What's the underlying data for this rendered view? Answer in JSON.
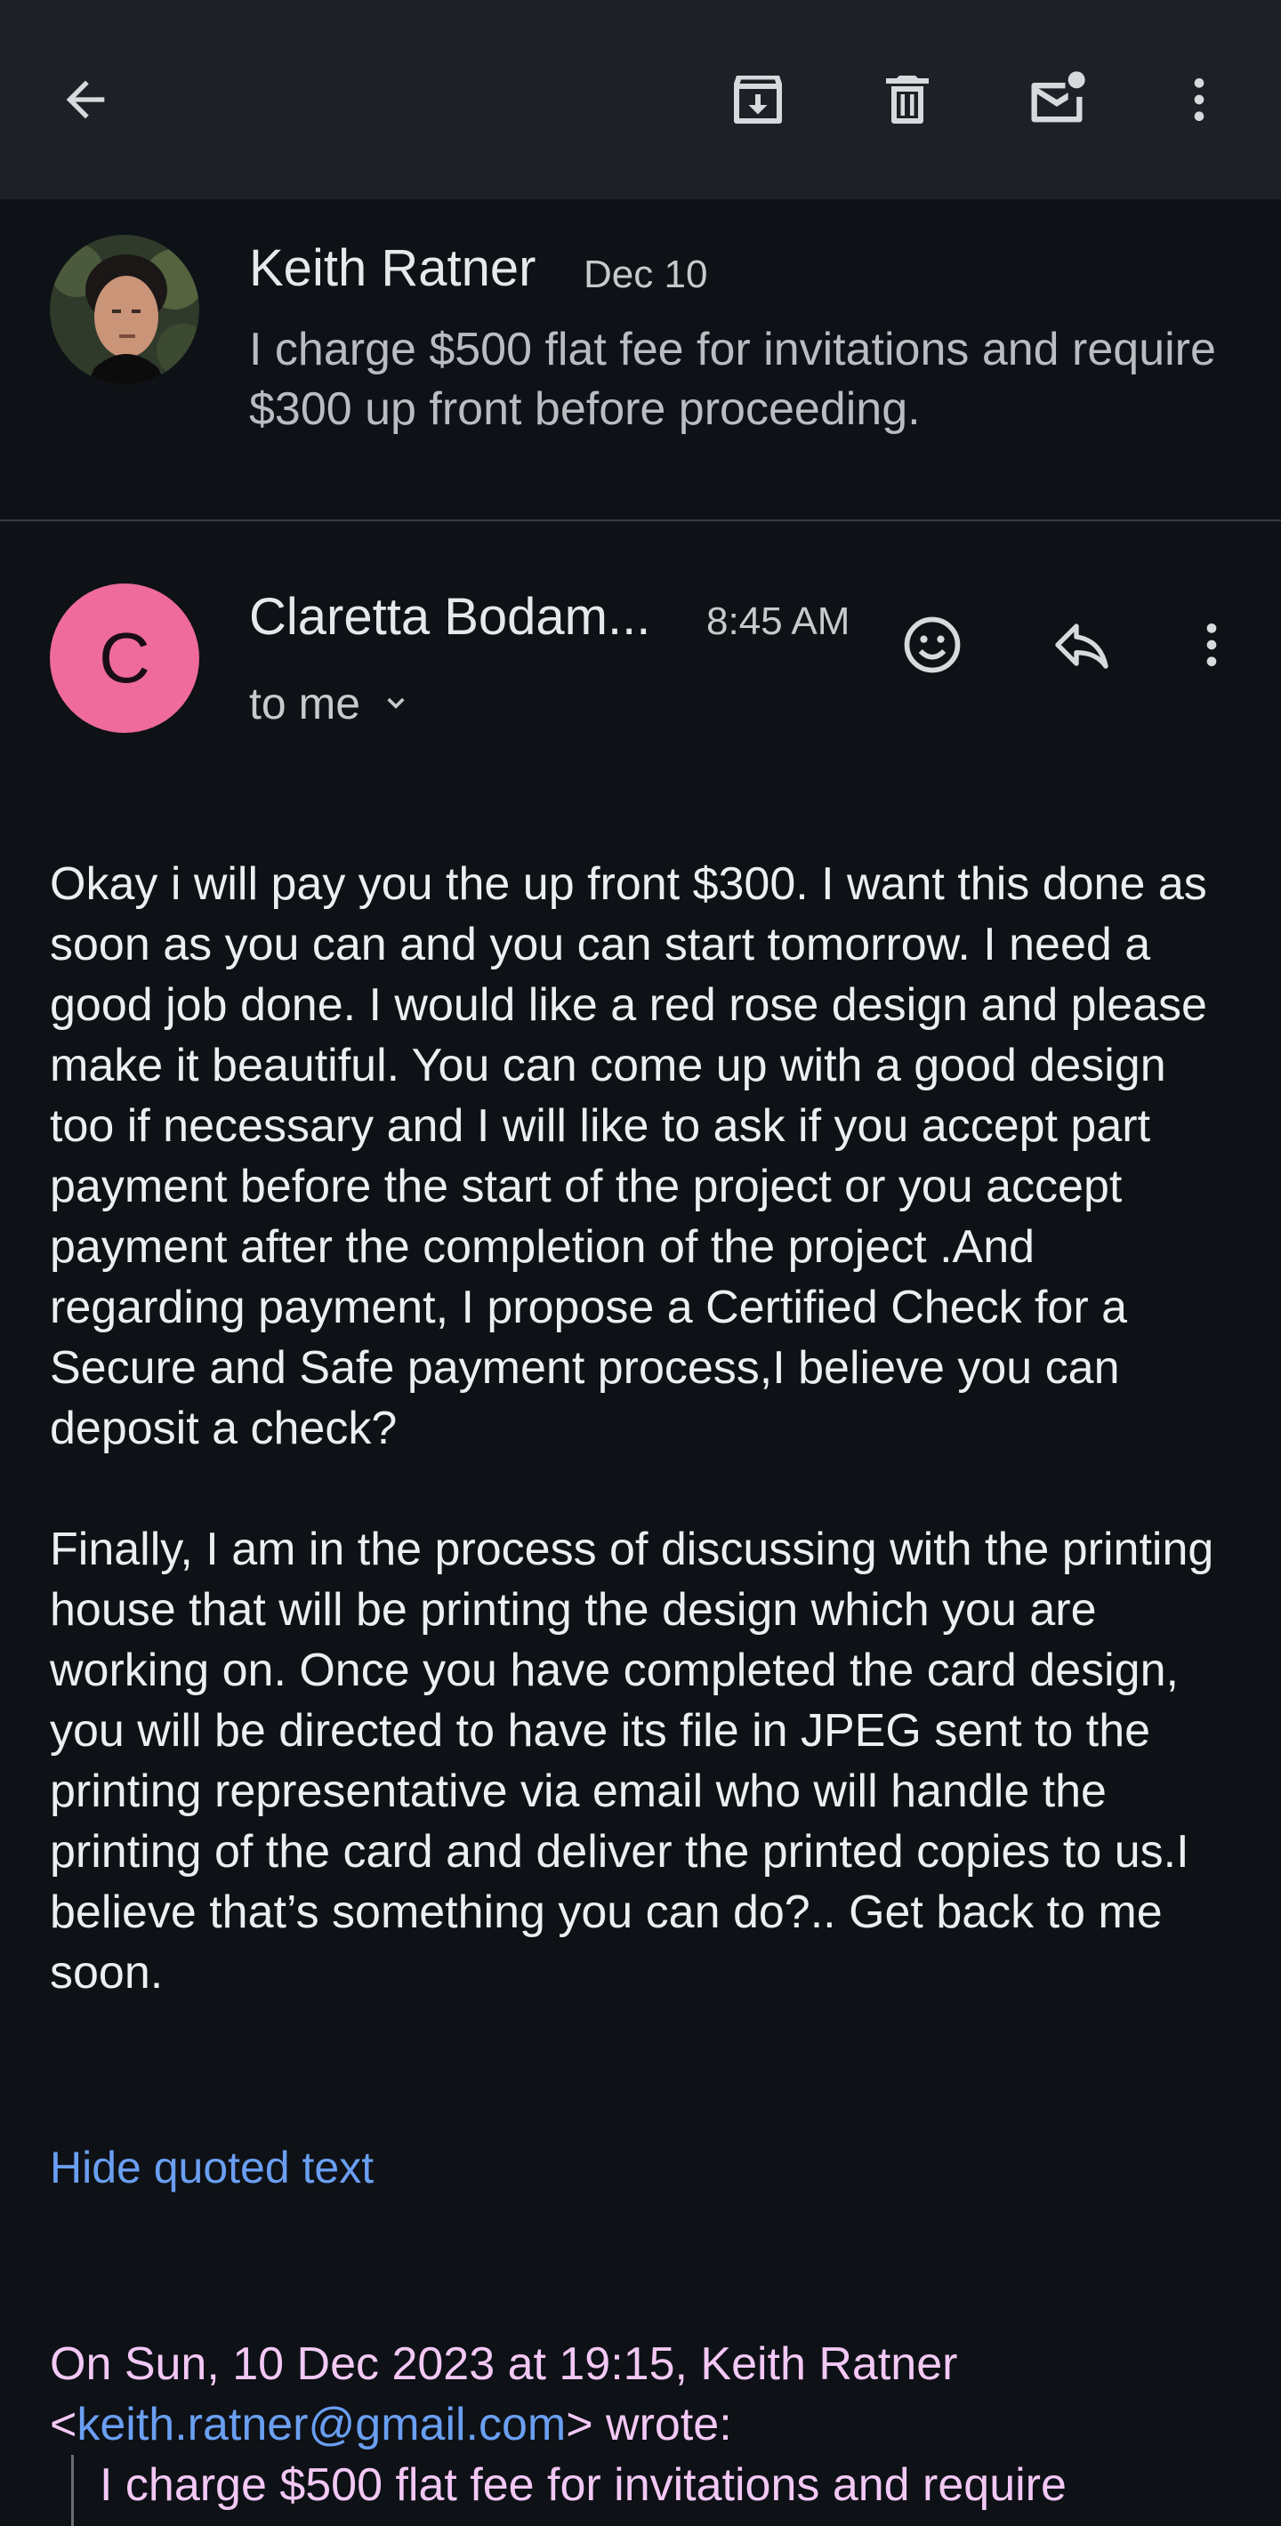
{
  "appbar": {
    "back_icon": "arrow-left-icon",
    "archive_icon": "archive-icon",
    "delete_icon": "trash-icon",
    "mark_unread_icon": "mail-unread-icon",
    "more_icon": "more-vertical-icon"
  },
  "previous_message": {
    "sender": "Keith Ratner",
    "date": "Dec 10",
    "snippet": "I charge $500 flat fee for invitations and require $300 up front before proceeding."
  },
  "message": {
    "avatar_letter": "C",
    "avatar_color": "#ee6b9a",
    "sender": "Claretta Bodam...",
    "time": "8:45 AM",
    "recipient": "to me",
    "body_paragraphs": [
      "Okay i will pay you the up front $300. I want this done as soon as you can and you can start tomorrow. I need a good job done. I would like a red rose design and please make it beautiful. You can come up with a good design too if necessary and I will like to ask if you accept part payment before the start of the project or you accept payment after the completion of the project .And regarding payment, I propose a Certified Check for a Secure and Safe payment process,I believe you can deposit a check?",
      "Finally, I am in the process of discussing with the printing house that will be printing the design which you are working on. Once you have completed the card design, you will be directed to have its file in JPEG sent to the printing representative via email who will handle the printing of the card and deliver the printed copies to us.I believe that’s something you can do?.. Get back to me soon."
    ],
    "hide_quoted_label": "Hide quoted text",
    "quote_header_prefix": "On Sun, 10 Dec 2023 at 19:15, Keith Ratner",
    "quote_open": "<",
    "quote_email": "keith.ratner@gmail.com",
    "quote_close": "> wrote:",
    "quoted_line": "I charge $500 flat fee for invitations and require"
  },
  "colors": {
    "background": "#0e1116",
    "appbar": "#1d2127",
    "link": "#6a9ff2",
    "quoted_text": "#f3c8f5"
  }
}
